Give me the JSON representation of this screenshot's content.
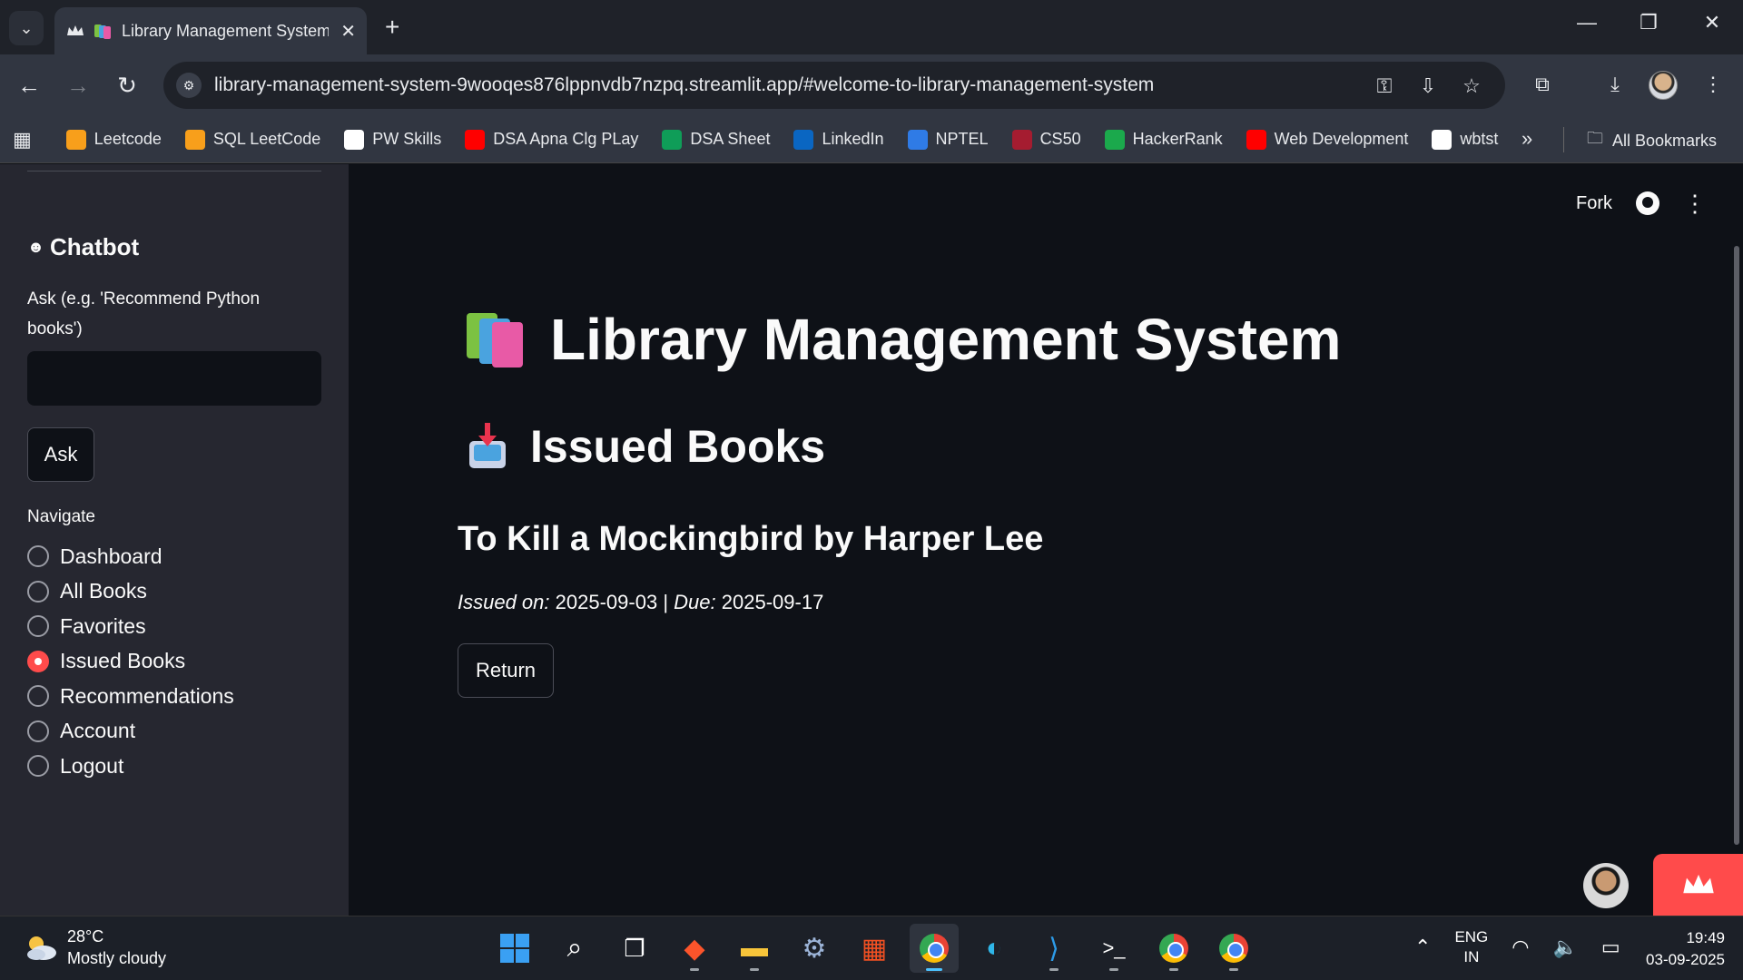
{
  "browser": {
    "tab_title": "Library Management System",
    "url": "library-management-system-9wooqes876lppnvdb7nzpq.streamlit.app/#welcome-to-library-management-system",
    "bookmarks": [
      {
        "label": "Leetcode",
        "icon": "leetcode-icon",
        "color": "#f89f1b"
      },
      {
        "label": "SQL LeetCode",
        "icon": "leetcode-icon",
        "color": "#f89f1b"
      },
      {
        "label": "PW Skills",
        "icon": "pwskills-icon",
        "color": "#ffffff"
      },
      {
        "label": "DSA Apna Clg PLay",
        "icon": "youtube-icon",
        "color": "#ff0000"
      },
      {
        "label": "DSA Sheet",
        "icon": "sheets-icon",
        "color": "#0f9d58"
      },
      {
        "label": "LinkedIn",
        "icon": "linkedin-icon",
        "color": "#0a66c2"
      },
      {
        "label": "NPTEL",
        "icon": "nptel-icon",
        "color": "#2f7be6"
      },
      {
        "label": "CS50",
        "icon": "cs50-icon",
        "color": "#a51c30"
      },
      {
        "label": "HackerRank",
        "icon": "hackerrank-icon",
        "color": "#1ba94c"
      },
      {
        "label": "Web Development",
        "icon": "youtube-icon",
        "color": "#ff0000"
      },
      {
        "label": "wbtst",
        "icon": "wbtst-icon",
        "color": "#ffffff"
      }
    ],
    "all_bookmarks_label": "All Bookmarks"
  },
  "sidebar": {
    "chatbot_heading": "Chatbot",
    "ask_label": "Ask (e.g. 'Recommend Python books')",
    "ask_input_value": "",
    "ask_button": "Ask",
    "navigate_label": "Navigate",
    "nav_items": [
      {
        "label": "Dashboard",
        "selected": false
      },
      {
        "label": "All Books",
        "selected": false
      },
      {
        "label": "Favorites",
        "selected": false
      },
      {
        "label": "Issued Books",
        "selected": true
      },
      {
        "label": "Recommendations",
        "selected": false
      },
      {
        "label": "Account",
        "selected": false
      },
      {
        "label": "Logout",
        "selected": false
      }
    ]
  },
  "header": {
    "fork_label": "Fork"
  },
  "main": {
    "app_title": "Library Management System",
    "section_title": "Issued Books",
    "book": {
      "title": "To Kill a Mockingbird by Harper Lee",
      "issued_label": "Issued on:",
      "issued_date": "2025-09-03",
      "separator": "|",
      "due_label": "Due:",
      "due_date": "2025-09-17"
    },
    "return_button": "Return"
  },
  "taskbar": {
    "temperature": "28°C",
    "weather": "Mostly cloudy",
    "lang_line1": "ENG",
    "lang_line2": "IN",
    "time": "19:49",
    "date": "03-09-2025"
  },
  "colors": {
    "accent": "#ff4b4b",
    "sidebar_bg": "#262730",
    "main_bg": "#0e1117"
  }
}
